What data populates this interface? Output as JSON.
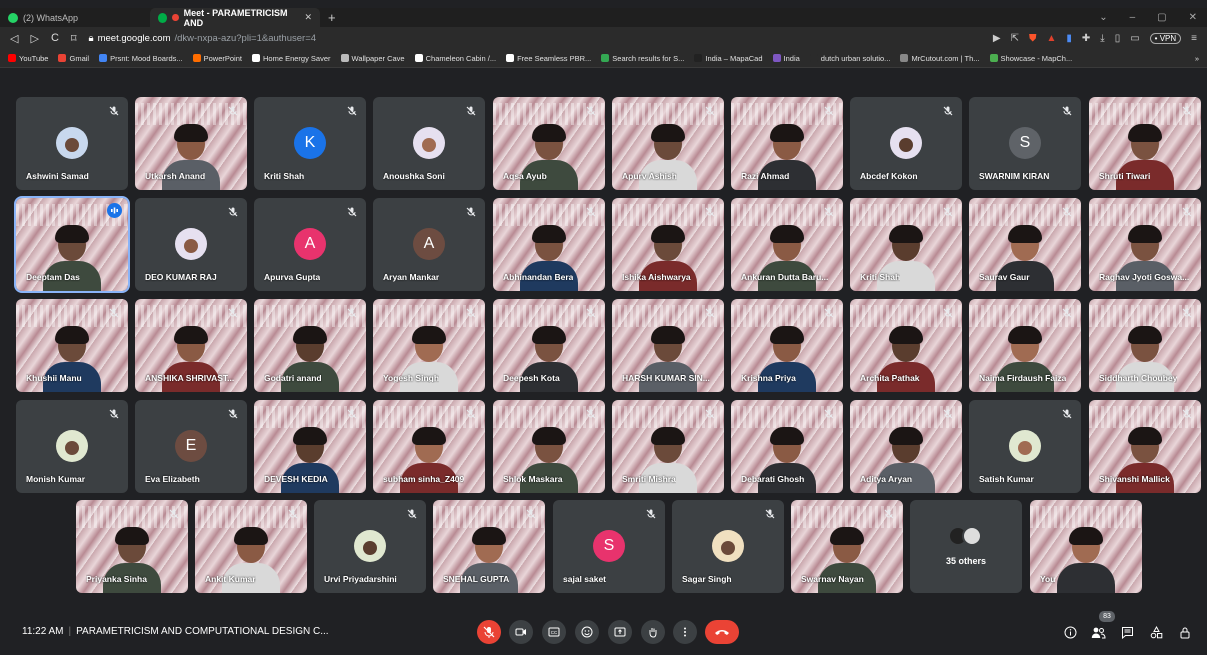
{
  "browser": {
    "tabs": [
      {
        "label": "(2) WhatsApp",
        "active": false
      },
      {
        "label": "Meet - PARAMETRICISM AND",
        "active": true
      }
    ],
    "new_tab": "+",
    "url_host": "meet.google.com",
    "url_path": "/dkw-nxpa-azu?pli=1&authuser=4",
    "vpn_label": "• VPN",
    "bookmarks": [
      "YouTube",
      "Gmail",
      "Prsnt: Mood Boards...",
      "PowerPoint",
      "Home Energy Saver",
      "Wallpaper Cave",
      "Chameleon Cabin /...",
      "Free Seamless PBR...",
      "Search results for S...",
      "India – MapaCad",
      "India",
      "dutch urban solutio...",
      "MrCutout.com | Th...",
      "Showcase - MapCh..."
    ],
    "bookmarks_more": "»"
  },
  "participants": [
    {
      "name": "Ashwini Samad",
      "kind": "photo",
      "muted": true
    },
    {
      "name": "Utkarsh Anand",
      "kind": "video",
      "muted": true
    },
    {
      "name": "Kriti Shah",
      "kind": "letter",
      "letter": "K",
      "color": "#1a73e8",
      "muted": true
    },
    {
      "name": "Anoushka Soni",
      "kind": "photo",
      "muted": true
    },
    {
      "name": "Aqsa Ayub",
      "kind": "video",
      "muted": true
    },
    {
      "name": "Apurv Ashish",
      "kind": "video",
      "muted": true
    },
    {
      "name": "Razi Ahmad",
      "kind": "video",
      "muted": true
    },
    {
      "name": "Abcdef Kokon",
      "kind": "photo",
      "muted": true
    },
    {
      "name": "SWARNIM KIRAN",
      "kind": "letter",
      "letter": "S",
      "color": "#5f6368",
      "muted": true
    },
    {
      "name": "Shruti Tiwari",
      "kind": "video",
      "muted": true
    },
    {
      "name": "Deeptam Das",
      "kind": "video",
      "muted": false,
      "speaking": true
    },
    {
      "name": "DEO KUMAR RAJ",
      "kind": "photo",
      "muted": true
    },
    {
      "name": "Apurva Gupta",
      "kind": "letter",
      "letter": "A",
      "color": "#e8336d",
      "muted": true
    },
    {
      "name": "Aryan Mankar",
      "kind": "letter",
      "letter": "A",
      "color": "#6d4c41",
      "muted": true
    },
    {
      "name": "Abhinandan Bera",
      "kind": "video",
      "muted": true
    },
    {
      "name": "Ishika Aishwarya",
      "kind": "video",
      "muted": true
    },
    {
      "name": "Ankuran Dutta Baru...",
      "kind": "video",
      "muted": true
    },
    {
      "name": "Kriti Shah",
      "kind": "video",
      "muted": true
    },
    {
      "name": "Saurav Gaur",
      "kind": "video",
      "muted": true
    },
    {
      "name": "Raghav Jyoti Goswa...",
      "kind": "video",
      "muted": true
    },
    {
      "name": "Khushii Manu",
      "kind": "video",
      "muted": true
    },
    {
      "name": "ANSHIKA SHRIVAST...",
      "kind": "video",
      "muted": true
    },
    {
      "name": "Godatri anand",
      "kind": "video",
      "muted": true
    },
    {
      "name": "Yogesh Singh",
      "kind": "video",
      "muted": true
    },
    {
      "name": "Deepesh Kota",
      "kind": "video",
      "muted": true
    },
    {
      "name": "HARSH KUMAR SIN...",
      "kind": "video",
      "muted": true
    },
    {
      "name": "Krishna Priya",
      "kind": "video",
      "muted": true
    },
    {
      "name": "Archita Pathak",
      "kind": "video",
      "muted": true
    },
    {
      "name": "Naima Firdaush Faiza",
      "kind": "video",
      "muted": true
    },
    {
      "name": "Siddharth Choubey",
      "kind": "video",
      "muted": true
    },
    {
      "name": "Monish Kumar",
      "kind": "photo",
      "muted": true
    },
    {
      "name": "Eva Elizabeth",
      "kind": "letter",
      "letter": "E",
      "color": "#6d4c41",
      "muted": true
    },
    {
      "name": "DEVESH KEDIA",
      "kind": "video",
      "muted": true
    },
    {
      "name": "subham sinha_Z409",
      "kind": "video",
      "muted": true
    },
    {
      "name": "Shlok Maskara",
      "kind": "video",
      "muted": true
    },
    {
      "name": "Smriti Mishra",
      "kind": "video",
      "muted": true
    },
    {
      "name": "Debarati Ghosh",
      "kind": "video",
      "muted": true
    },
    {
      "name": "Aditya Aryan",
      "kind": "video",
      "muted": true
    },
    {
      "name": "Satish Kumar",
      "kind": "photo",
      "muted": true
    },
    {
      "name": "Shivanshi Mallick",
      "kind": "video",
      "muted": true
    },
    {
      "name": "Priyanka Sinha",
      "kind": "video",
      "muted": true
    },
    {
      "name": "Ankit Kumar",
      "kind": "video",
      "muted": true
    },
    {
      "name": "Urvi Priyadarshini",
      "kind": "photo",
      "muted": true
    },
    {
      "name": "SNEHAL GUPTA",
      "kind": "video",
      "muted": true
    },
    {
      "name": "sajal saket",
      "kind": "letter",
      "letter": "S",
      "color": "#e8336d",
      "muted": true
    },
    {
      "name": "Sagar Singh",
      "kind": "photo",
      "muted": true
    },
    {
      "name": "Swarnav Nayan",
      "kind": "video",
      "muted": true
    },
    {
      "name": "35 others",
      "kind": "others",
      "muted": false
    },
    {
      "name": "You",
      "kind": "video",
      "muted": false
    }
  ],
  "bottom": {
    "time": "11:22 AM",
    "separator": "|",
    "meeting_title": "PARAMETRICISM AND COMPUTATIONAL DESIGN C...",
    "participant_count": "83"
  },
  "colors": {
    "speaking_outline": "#8ab4f8",
    "end_call": "#ea4335",
    "accent": "#1a73e8"
  }
}
